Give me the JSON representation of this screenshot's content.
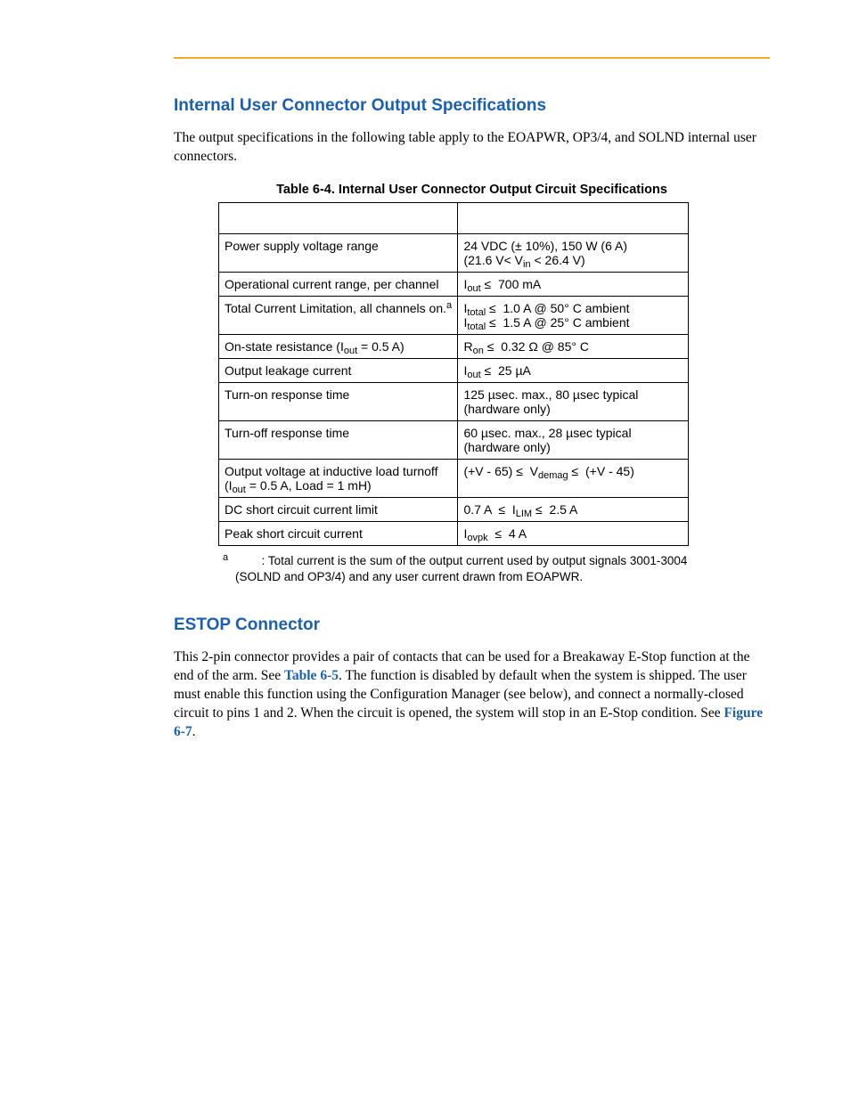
{
  "section1": {
    "heading": "Internal User Connector Output Specifications",
    "intro": "The output specifications in the following table apply to the EOAPWR, OP3/4, and SOLND internal user connectors.",
    "table_caption": "Table 6-4. Internal User Connector Output Circuit Specifications",
    "rows": [
      {
        "param_html": "Power supply voltage range",
        "value_html": "24 VDC (± 10%), 150 W (6 A)<br>(21.6 V&lt; V<sub>in</sub> &lt; 26.4 V)"
      },
      {
        "param_html": "Operational current range, per channel",
        "value_html": "I<sub>out</sub> ≤ &nbsp;700 mA"
      },
      {
        "param_html": "Total Current Limitation, all channels on.<sup>a</sup>",
        "value_html": "I<sub>total</sub> ≤ &nbsp;1.0 A @ 50° C ambient<br>I<sub>total</sub> ≤ &nbsp;1.5 A @ 25° C ambient"
      },
      {
        "param_html": "On-state resistance (I<sub>out</sub> = 0.5 A)",
        "value_html": "R<sub>on</sub> ≤ &nbsp;0.32 Ω @ 85° C"
      },
      {
        "param_html": "Output leakage current",
        "value_html": "I<sub>out</sub> ≤ &nbsp;25 µA"
      },
      {
        "param_html": "Turn-on response time",
        "value_html": "125 µsec. max., 80 µsec typical (hardware only)"
      },
      {
        "param_html": "Turn-off response time",
        "value_html": "60 µsec. max., 28 µsec typical (hardware only)"
      },
      {
        "param_html": "Output voltage at inductive load turnoff (I<sub>out</sub> = 0.5 A, Load = 1 mH)",
        "value_html": "(+V - 65) ≤ &nbsp;V<sub>demag</sub> ≤ &nbsp;(+V - 45)"
      },
      {
        "param_html": "DC short circuit current limit",
        "value_html": "0.7 A &nbsp;≤ &nbsp;I<sub>LIM</sub> ≤ &nbsp;2.5 A"
      },
      {
        "param_html": "Peak short circuit current",
        "value_html": "I<sub>ovpk</sub> &nbsp;≤ &nbsp;4 A"
      }
    ],
    "footnote_html": "<sup>a</sup> &nbsp;&nbsp;&nbsp;&nbsp;&nbsp;&nbsp;&nbsp;&nbsp;&nbsp;: Total current is the sum of the output current used by output signals 3001-3004 (SOLND and OP3/4) and any user current drawn from EOAPWR."
  },
  "section2": {
    "heading": "ESTOP Connector",
    "body_html": "This 2-pin connector provides a pair of contacts that can be used for a Breakaway E-Stop function at the end of the arm. See <a class=\"xref\" data-name=\"xref-table-6-5\" data-interactable=\"true\">Table 6-5</a>. The function is disabled by default when the system is shipped. The user must enable this function using the Configuration Manager (see below), and connect a normally-closed circuit to pins 1 and 2. When the circuit is opened, the system will stop in an E-Stop condition. See <a class=\"xref\" data-name=\"xref-figure-6-7\" data-interactable=\"true\">Figure 6-7</a>."
  }
}
